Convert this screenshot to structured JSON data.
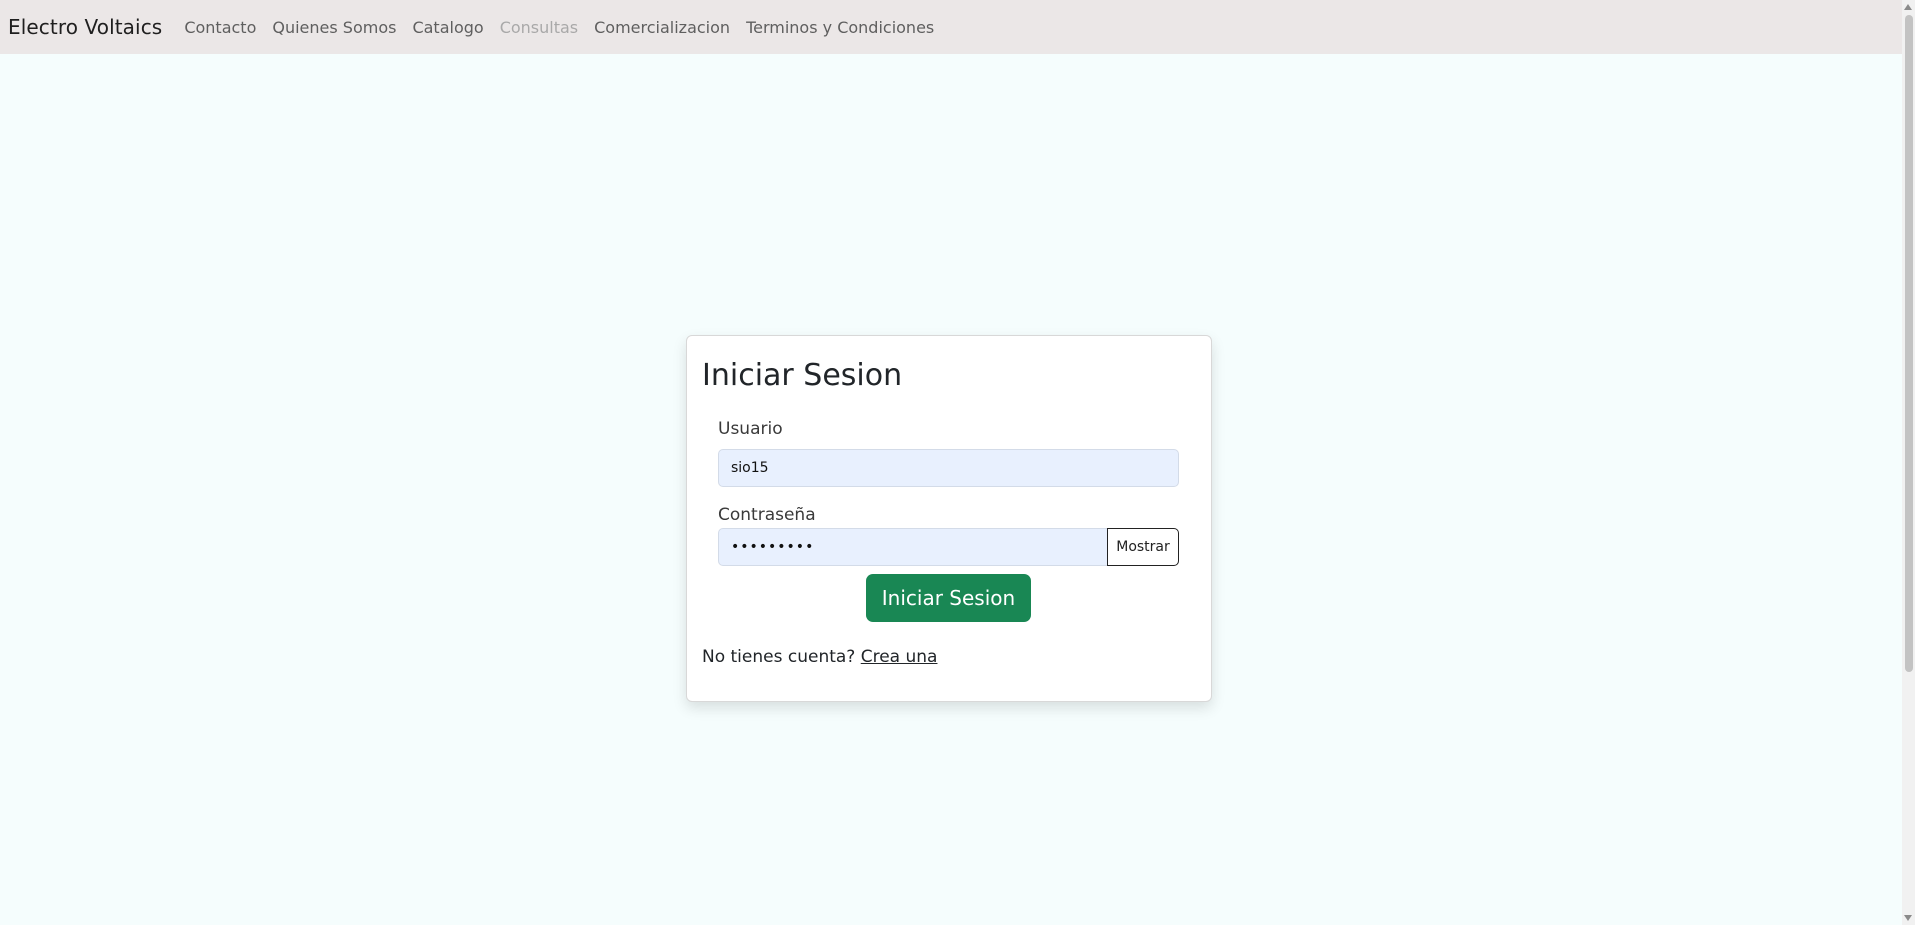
{
  "navbar": {
    "brand": "Electro Voltaics",
    "links": [
      {
        "label": "Contacto",
        "disabled": false
      },
      {
        "label": "Quienes Somos",
        "disabled": false
      },
      {
        "label": "Catalogo",
        "disabled": false
      },
      {
        "label": "Consultas",
        "disabled": true
      },
      {
        "label": "Comercializacion",
        "disabled": false
      },
      {
        "label": "Terminos y Condiciones",
        "disabled": false
      }
    ]
  },
  "login": {
    "title": "Iniciar Sesion",
    "username_label": "Usuario",
    "username_value": "sio15",
    "password_label": "Contraseña",
    "password_value": "sio15sio1",
    "show_button": "Mostrar",
    "submit_button": "Iniciar Sesion",
    "signup_prompt": "No tienes cuenta?",
    "signup_link": "Crea una"
  },
  "colors": {
    "navbar_bg": "#ebe7e7",
    "page_bg": "#f5fdfd",
    "primary_button": "#198754",
    "input_autofill_bg": "#e8f0fe"
  }
}
